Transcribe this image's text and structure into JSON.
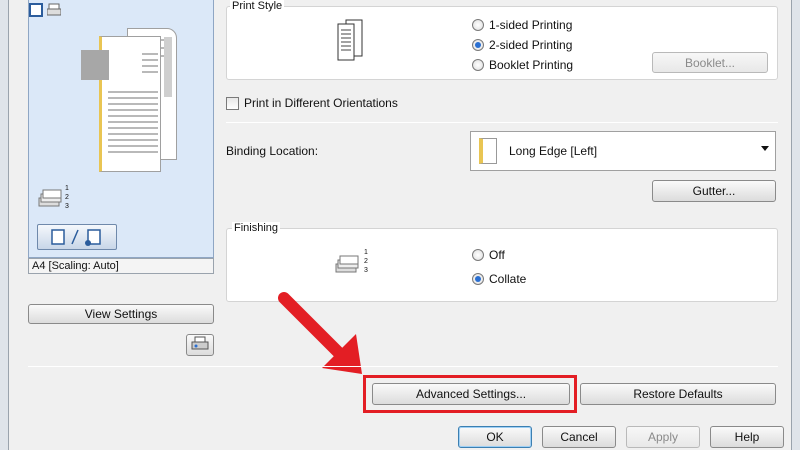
{
  "print_style": {
    "legend": "Print Style",
    "options": [
      "1-sided Printing",
      "2-sided Printing",
      "Booklet Printing"
    ],
    "selected": "2-sided Printing",
    "booklet_button": "Booklet..."
  },
  "orientation_checkbox": {
    "label": "Print in Different Orientations",
    "checked": false
  },
  "binding": {
    "label": "Binding Location:",
    "value": "Long Edge [Left]",
    "gutter_button": "Gutter..."
  },
  "finishing": {
    "legend": "Finishing",
    "options": [
      "Off",
      "Collate"
    ],
    "selected": "Collate"
  },
  "preview": {
    "status": "A4 [Scaling: Auto]",
    "view_settings_button": "View Settings",
    "stack_numbers": [
      "1",
      "2",
      "3"
    ]
  },
  "actions": {
    "advanced_settings": "Advanced Settings...",
    "restore_defaults": "Restore Defaults"
  },
  "dialog_buttons": {
    "ok": "OK",
    "cancel": "Cancel",
    "apply": "Apply",
    "help": "Help"
  },
  "colors": {
    "highlight": "#e31e24",
    "arrow": "#e31e24",
    "radio_selected": "#2a6fd1"
  },
  "annotation": {
    "arrow_icon": "red-arrow-icon"
  }
}
